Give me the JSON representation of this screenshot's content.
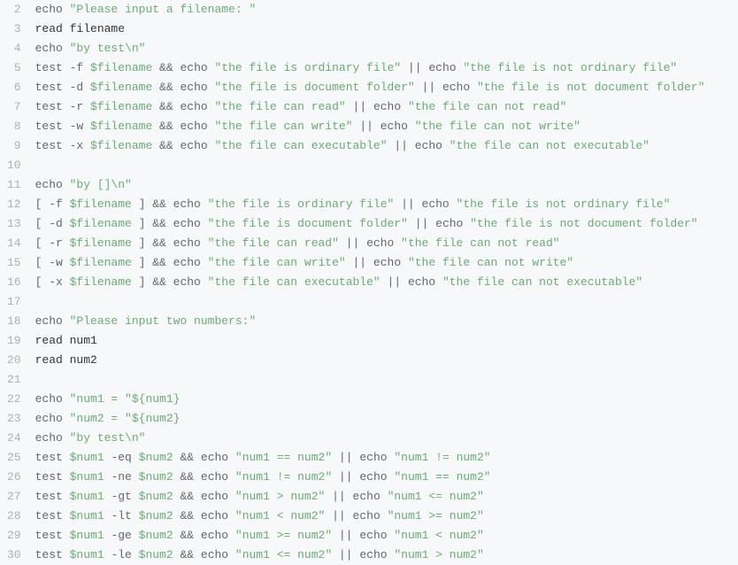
{
  "lines": [
    {
      "n": 2,
      "tokens": [
        {
          "t": "echo ",
          "c": "cmd"
        },
        {
          "t": "\"Please input a filename: \"",
          "c": "str"
        }
      ]
    },
    {
      "n": 3,
      "tokens": [
        {
          "t": "read filename",
          "c": "txt"
        }
      ]
    },
    {
      "n": 4,
      "tokens": [
        {
          "t": "echo ",
          "c": "cmd"
        },
        {
          "t": "\"by test\\n\"",
          "c": "str"
        }
      ]
    },
    {
      "n": 5,
      "tokens": [
        {
          "t": "test -f ",
          "c": "cmd"
        },
        {
          "t": "$filename",
          "c": "var"
        },
        {
          "t": " && ",
          "c": "op"
        },
        {
          "t": "echo ",
          "c": "cmd"
        },
        {
          "t": "\"the file is ordinary file\"",
          "c": "str"
        },
        {
          "t": " || ",
          "c": "op"
        },
        {
          "t": "echo ",
          "c": "cmd"
        },
        {
          "t": "\"the file is not ordinary file\"",
          "c": "str"
        }
      ]
    },
    {
      "n": 6,
      "tokens": [
        {
          "t": "test -d ",
          "c": "cmd"
        },
        {
          "t": "$filename",
          "c": "var"
        },
        {
          "t": " && ",
          "c": "op"
        },
        {
          "t": "echo ",
          "c": "cmd"
        },
        {
          "t": "\"the file is document folder\"",
          "c": "str"
        },
        {
          "t": " || ",
          "c": "op"
        },
        {
          "t": "echo ",
          "c": "cmd"
        },
        {
          "t": "\"the file is not document folder\"",
          "c": "str"
        }
      ]
    },
    {
      "n": 7,
      "tokens": [
        {
          "t": "test -r ",
          "c": "cmd"
        },
        {
          "t": "$filename",
          "c": "var"
        },
        {
          "t": " && ",
          "c": "op"
        },
        {
          "t": "echo ",
          "c": "cmd"
        },
        {
          "t": "\"the file can read\"",
          "c": "str"
        },
        {
          "t": " || ",
          "c": "op"
        },
        {
          "t": "echo ",
          "c": "cmd"
        },
        {
          "t": "\"the file can not read\"",
          "c": "str"
        }
      ]
    },
    {
      "n": 8,
      "tokens": [
        {
          "t": "test -w ",
          "c": "cmd"
        },
        {
          "t": "$filename",
          "c": "var"
        },
        {
          "t": " && ",
          "c": "op"
        },
        {
          "t": "echo ",
          "c": "cmd"
        },
        {
          "t": "\"the file can write\"",
          "c": "str"
        },
        {
          "t": " || ",
          "c": "op"
        },
        {
          "t": "echo ",
          "c": "cmd"
        },
        {
          "t": "\"the file can not write\"",
          "c": "str"
        }
      ]
    },
    {
      "n": 9,
      "tokens": [
        {
          "t": "test -x ",
          "c": "cmd"
        },
        {
          "t": "$filename",
          "c": "var"
        },
        {
          "t": " && ",
          "c": "op"
        },
        {
          "t": "echo ",
          "c": "cmd"
        },
        {
          "t": "\"the file can executable\"",
          "c": "str"
        },
        {
          "t": " || ",
          "c": "op"
        },
        {
          "t": "echo ",
          "c": "cmd"
        },
        {
          "t": "\"the file can not executable\"",
          "c": "str"
        }
      ]
    },
    {
      "n": 10,
      "tokens": []
    },
    {
      "n": 11,
      "tokens": [
        {
          "t": "echo ",
          "c": "cmd"
        },
        {
          "t": "\"by []\\n\"",
          "c": "str"
        }
      ]
    },
    {
      "n": 12,
      "tokens": [
        {
          "t": "[ -f ",
          "c": "cmd"
        },
        {
          "t": "$filename",
          "c": "var"
        },
        {
          "t": " ] ",
          "c": "cmd"
        },
        {
          "t": "&& ",
          "c": "op"
        },
        {
          "t": "echo ",
          "c": "cmd"
        },
        {
          "t": "\"the file is ordinary file\"",
          "c": "str"
        },
        {
          "t": " || ",
          "c": "op"
        },
        {
          "t": "echo ",
          "c": "cmd"
        },
        {
          "t": "\"the file is not ordinary file\"",
          "c": "str"
        }
      ]
    },
    {
      "n": 13,
      "tokens": [
        {
          "t": "[ -d ",
          "c": "cmd"
        },
        {
          "t": "$filename",
          "c": "var"
        },
        {
          "t": " ] ",
          "c": "cmd"
        },
        {
          "t": "&& ",
          "c": "op"
        },
        {
          "t": "echo ",
          "c": "cmd"
        },
        {
          "t": "\"the file is document folder\"",
          "c": "str"
        },
        {
          "t": " || ",
          "c": "op"
        },
        {
          "t": "echo ",
          "c": "cmd"
        },
        {
          "t": "\"the file is not document folder\"",
          "c": "str"
        }
      ]
    },
    {
      "n": 14,
      "tokens": [
        {
          "t": "[ -r ",
          "c": "cmd"
        },
        {
          "t": "$filename",
          "c": "var"
        },
        {
          "t": " ] ",
          "c": "cmd"
        },
        {
          "t": "&& ",
          "c": "op"
        },
        {
          "t": "echo ",
          "c": "cmd"
        },
        {
          "t": "\"the file can read\"",
          "c": "str"
        },
        {
          "t": " || ",
          "c": "op"
        },
        {
          "t": "echo ",
          "c": "cmd"
        },
        {
          "t": "\"the file can not read\"",
          "c": "str"
        }
      ]
    },
    {
      "n": 15,
      "tokens": [
        {
          "t": "[ -w ",
          "c": "cmd"
        },
        {
          "t": "$filename",
          "c": "var"
        },
        {
          "t": " ] ",
          "c": "cmd"
        },
        {
          "t": "&& ",
          "c": "op"
        },
        {
          "t": "echo ",
          "c": "cmd"
        },
        {
          "t": "\"the file can write\"",
          "c": "str"
        },
        {
          "t": " || ",
          "c": "op"
        },
        {
          "t": "echo ",
          "c": "cmd"
        },
        {
          "t": "\"the file can not write\"",
          "c": "str"
        }
      ]
    },
    {
      "n": 16,
      "tokens": [
        {
          "t": "[ -x ",
          "c": "cmd"
        },
        {
          "t": "$filename",
          "c": "var"
        },
        {
          "t": " ] ",
          "c": "cmd"
        },
        {
          "t": "&& ",
          "c": "op"
        },
        {
          "t": "echo ",
          "c": "cmd"
        },
        {
          "t": "\"the file can executable\"",
          "c": "str"
        },
        {
          "t": " || ",
          "c": "op"
        },
        {
          "t": "echo ",
          "c": "cmd"
        },
        {
          "t": "\"the file can not executable\"",
          "c": "str"
        }
      ]
    },
    {
      "n": 17,
      "tokens": []
    },
    {
      "n": 18,
      "tokens": [
        {
          "t": "echo ",
          "c": "cmd"
        },
        {
          "t": "\"Please input two numbers:\"",
          "c": "str"
        }
      ]
    },
    {
      "n": 19,
      "tokens": [
        {
          "t": "read num1",
          "c": "txt"
        }
      ]
    },
    {
      "n": 20,
      "tokens": [
        {
          "t": "read num2",
          "c": "txt"
        }
      ]
    },
    {
      "n": 21,
      "tokens": []
    },
    {
      "n": 22,
      "tokens": [
        {
          "t": "echo ",
          "c": "cmd"
        },
        {
          "t": "\"num1 = \"",
          "c": "str"
        },
        {
          "t": "${num1}",
          "c": "var"
        }
      ]
    },
    {
      "n": 23,
      "tokens": [
        {
          "t": "echo ",
          "c": "cmd"
        },
        {
          "t": "\"num2 = \"",
          "c": "str"
        },
        {
          "t": "${num2}",
          "c": "var"
        }
      ]
    },
    {
      "n": 24,
      "tokens": [
        {
          "t": "echo ",
          "c": "cmd"
        },
        {
          "t": "\"by test\\n\"",
          "c": "str"
        }
      ]
    },
    {
      "n": 25,
      "tokens": [
        {
          "t": "test ",
          "c": "cmd"
        },
        {
          "t": "$num1",
          "c": "var"
        },
        {
          "t": " -eq ",
          "c": "cmd"
        },
        {
          "t": "$num2",
          "c": "var"
        },
        {
          "t": " && ",
          "c": "op"
        },
        {
          "t": "echo ",
          "c": "cmd"
        },
        {
          "t": "\"num1 == num2\"",
          "c": "str"
        },
        {
          "t": " || ",
          "c": "op"
        },
        {
          "t": "echo ",
          "c": "cmd"
        },
        {
          "t": "\"num1 != num2\"",
          "c": "str"
        }
      ]
    },
    {
      "n": 26,
      "tokens": [
        {
          "t": "test ",
          "c": "cmd"
        },
        {
          "t": "$num1",
          "c": "var"
        },
        {
          "t": " -ne ",
          "c": "cmd"
        },
        {
          "t": "$num2",
          "c": "var"
        },
        {
          "t": " && ",
          "c": "op"
        },
        {
          "t": "echo ",
          "c": "cmd"
        },
        {
          "t": "\"num1 != num2\"",
          "c": "str"
        },
        {
          "t": " || ",
          "c": "op"
        },
        {
          "t": "echo ",
          "c": "cmd"
        },
        {
          "t": "\"num1 == num2\"",
          "c": "str"
        }
      ]
    },
    {
      "n": 27,
      "tokens": [
        {
          "t": "test ",
          "c": "cmd"
        },
        {
          "t": "$num1",
          "c": "var"
        },
        {
          "t": " -gt ",
          "c": "cmd"
        },
        {
          "t": "$num2",
          "c": "var"
        },
        {
          "t": " && ",
          "c": "op"
        },
        {
          "t": "echo ",
          "c": "cmd"
        },
        {
          "t": "\"num1 > num2\"",
          "c": "str"
        },
        {
          "t": " || ",
          "c": "op"
        },
        {
          "t": "echo ",
          "c": "cmd"
        },
        {
          "t": "\"num1 <= num2\"",
          "c": "str"
        }
      ]
    },
    {
      "n": 28,
      "tokens": [
        {
          "t": "test ",
          "c": "cmd"
        },
        {
          "t": "$num1",
          "c": "var"
        },
        {
          "t": " -lt ",
          "c": "cmd"
        },
        {
          "t": "$num2",
          "c": "var"
        },
        {
          "t": " && ",
          "c": "op"
        },
        {
          "t": "echo ",
          "c": "cmd"
        },
        {
          "t": "\"num1 < num2\"",
          "c": "str"
        },
        {
          "t": " || ",
          "c": "op"
        },
        {
          "t": "echo ",
          "c": "cmd"
        },
        {
          "t": "\"num1 >= num2\"",
          "c": "str"
        }
      ]
    },
    {
      "n": 29,
      "tokens": [
        {
          "t": "test ",
          "c": "cmd"
        },
        {
          "t": "$num1",
          "c": "var"
        },
        {
          "t": " -ge ",
          "c": "cmd"
        },
        {
          "t": "$num2",
          "c": "var"
        },
        {
          "t": " && ",
          "c": "op"
        },
        {
          "t": "echo ",
          "c": "cmd"
        },
        {
          "t": "\"num1 >= num2\"",
          "c": "str"
        },
        {
          "t": " || ",
          "c": "op"
        },
        {
          "t": "echo ",
          "c": "cmd"
        },
        {
          "t": "\"num1 < num2\"",
          "c": "str"
        }
      ]
    },
    {
      "n": 30,
      "tokens": [
        {
          "t": "test ",
          "c": "cmd"
        },
        {
          "t": "$num1",
          "c": "var"
        },
        {
          "t": " -le ",
          "c": "cmd"
        },
        {
          "t": "$num2",
          "c": "var"
        },
        {
          "t": " && ",
          "c": "op"
        },
        {
          "t": "echo ",
          "c": "cmd"
        },
        {
          "t": "\"num1 <= num2\"",
          "c": "str"
        },
        {
          "t": " || ",
          "c": "op"
        },
        {
          "t": "echo ",
          "c": "cmd"
        },
        {
          "t": "\"num1 > num2\"",
          "c": "str"
        }
      ]
    }
  ]
}
